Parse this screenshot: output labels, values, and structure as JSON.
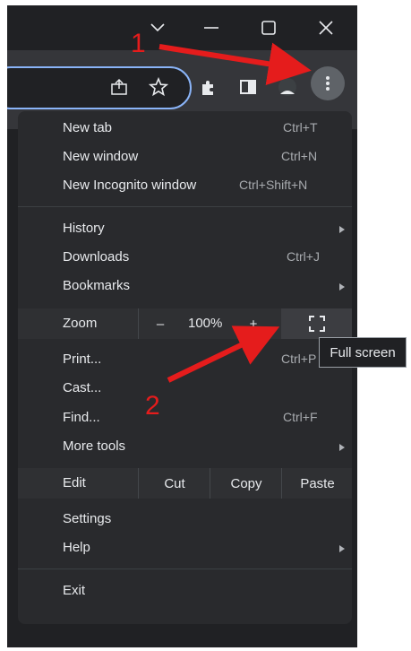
{
  "window_controls": [
    {
      "name": "tab-search",
      "icon": "chevron-down-icon"
    },
    {
      "name": "minimize",
      "icon": "minimize-icon"
    },
    {
      "name": "maximize",
      "icon": "maximize-icon"
    },
    {
      "name": "close",
      "icon": "close-icon"
    }
  ],
  "toolbar_icons": [
    "share-icon",
    "star-icon",
    "extensions-puzzle-icon",
    "side-panel-icon",
    "profile-icon",
    "more-vertical-icon"
  ],
  "menu": {
    "new_tab": {
      "label": "New tab",
      "shortcut": "Ctrl+T"
    },
    "new_window": {
      "label": "New window",
      "shortcut": "Ctrl+N"
    },
    "new_incognito": {
      "label": "New Incognito window",
      "shortcut": "Ctrl+Shift+N"
    },
    "history": {
      "label": "History"
    },
    "downloads": {
      "label": "Downloads",
      "shortcut": "Ctrl+J"
    },
    "bookmarks": {
      "label": "Bookmarks"
    },
    "zoom": {
      "label": "Zoom",
      "minus": "–",
      "level": "100%",
      "plus": "+"
    },
    "print": {
      "label": "Print...",
      "shortcut": "Ctrl+P"
    },
    "cast": {
      "label": "Cast..."
    },
    "find": {
      "label": "Find...",
      "shortcut": "Ctrl+F"
    },
    "more_tools": {
      "label": "More tools"
    },
    "edit": {
      "label": "Edit",
      "cut": "Cut",
      "copy": "Copy",
      "paste": "Paste"
    },
    "settings": {
      "label": "Settings"
    },
    "help": {
      "label": "Help"
    },
    "exit": {
      "label": "Exit"
    }
  },
  "tooltip": "Full screen",
  "annotations": {
    "step1": "1",
    "step2": "2",
    "color": "#e51c1c"
  },
  "colors": {
    "menu_bg": "#292a2d",
    "toolbar_bg": "#35363a",
    "accent": "#8ab4f8"
  }
}
